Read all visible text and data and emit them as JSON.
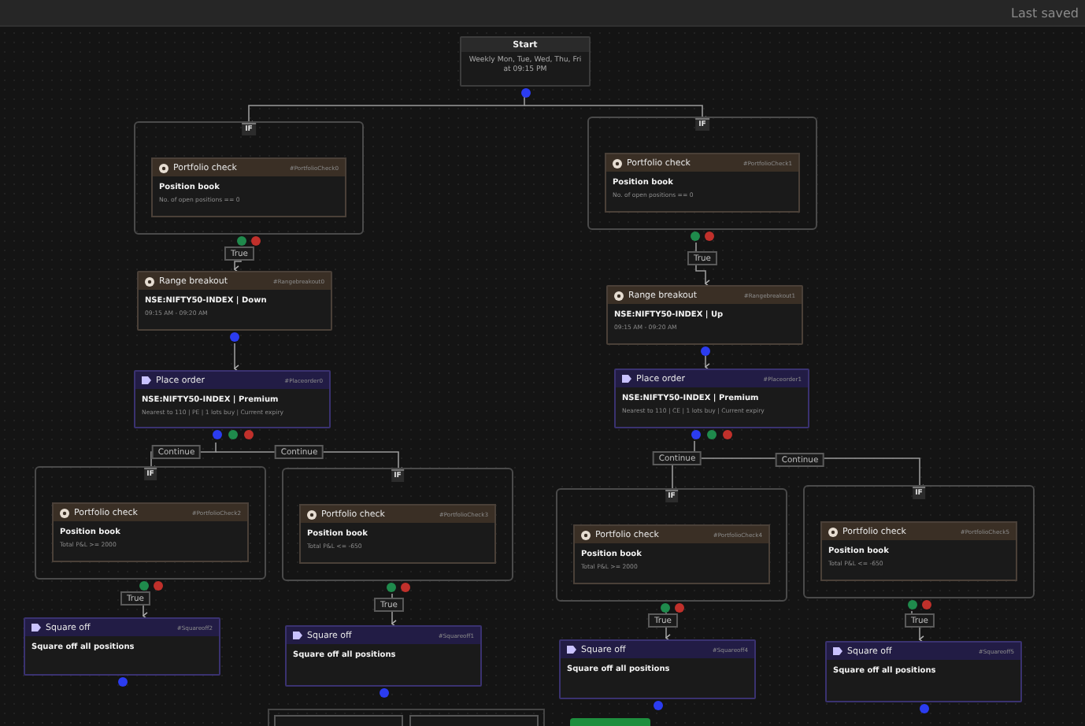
{
  "top_bar": {
    "status": "Last saved"
  },
  "nodes": [
    {
      "kind": "start",
      "title": "Start",
      "detail": "Weekly Mon, Tue, Wed, Thu, Fri at 09:15 PM",
      "ports": [
        {
          "color": "#2b3cf0"
        }
      ]
    },
    {
      "kind": "condition",
      "badge": "IF",
      "title": "Portfolio check",
      "tag": "#PortfolioCheck0",
      "heading": "Position book",
      "detail": "No. of open positions == 0",
      "ports": [
        {
          "color": "#1f8a4c"
        },
        {
          "color": "#c0302b"
        }
      ]
    },
    {
      "kind": "range_breakout",
      "title": "Range breakout",
      "tag": "#Rangebreakout0",
      "heading": "NSE:NIFTY50-INDEX | Down",
      "detail": "09:15 AM - 09:20 AM",
      "ports": [
        {
          "color": "#2b3cf0"
        }
      ]
    },
    {
      "kind": "place_order",
      "title": "Place order",
      "tag": "#Placeorder0",
      "heading": "NSE:NIFTY50-INDEX | Premium",
      "detail": "Nearest to 110 | PE | 1 lots buy | Current expiry",
      "ports": [
        {
          "color": "#2b3cf0"
        },
        {
          "color": "#1f8a4c"
        },
        {
          "color": "#c0302b"
        }
      ]
    },
    {
      "kind": "condition",
      "badge": "IF",
      "title": "Portfolio check",
      "tag": "#PortfolioCheck2",
      "heading": "Position book",
      "detail": "Total P&L >= 2000",
      "ports": [
        {
          "color": "#1f8a4c"
        },
        {
          "color": "#c0302b"
        }
      ]
    },
    {
      "kind": "square_off",
      "title": "Square off",
      "tag": "#Squareoff2",
      "heading": "Square off all positions",
      "ports": [
        {
          "color": "#2b3cf0"
        }
      ]
    },
    {
      "kind": "condition",
      "badge": "IF",
      "title": "Portfolio check",
      "tag": "#PortfolioCheck3",
      "heading": "Position book",
      "detail": "Total P&L <= -650",
      "ports": [
        {
          "color": "#1f8a4c"
        },
        {
          "color": "#c0302b"
        }
      ]
    },
    {
      "kind": "square_off",
      "title": "Square off",
      "tag": "#Squareoff1",
      "heading": "Square off all positions",
      "ports": [
        {
          "color": "#2b3cf0"
        }
      ]
    },
    {
      "kind": "condition",
      "badge": "IF",
      "title": "Portfolio check",
      "tag": "#PortfolioCheck1",
      "heading": "Position book",
      "detail": "No. of open positions == 0",
      "ports": [
        {
          "color": "#1f8a4c"
        },
        {
          "color": "#c0302b"
        }
      ]
    },
    {
      "kind": "range_breakout",
      "title": "Range breakout",
      "tag": "#Rangebreakout1",
      "heading": "NSE:NIFTY50-INDEX | Up",
      "detail": "09:15 AM - 09:20 AM",
      "ports": [
        {
          "color": "#2b3cf0"
        }
      ]
    },
    {
      "kind": "place_order",
      "title": "Place order",
      "tag": "#Placeorder1",
      "heading": "NSE:NIFTY50-INDEX | Premium",
      "detail": "Nearest to 110 | CE | 1 lots buy | Current expiry",
      "ports": [
        {
          "color": "#2b3cf0"
        },
        {
          "color": "#1f8a4c"
        },
        {
          "color": "#c0302b"
        }
      ]
    },
    {
      "kind": "condition",
      "badge": "IF",
      "title": "Portfolio check",
      "tag": "#PortfolioCheck4",
      "heading": "Position book",
      "detail": "Total P&L >= 2000",
      "ports": [
        {
          "color": "#1f8a4c"
        },
        {
          "color": "#c0302b"
        }
      ]
    },
    {
      "kind": "square_off",
      "title": "Square off",
      "tag": "#Squareoff4",
      "heading": "Square off all positions",
      "ports": [
        {
          "color": "#2b3cf0"
        }
      ]
    },
    {
      "kind": "condition",
      "badge": "IF",
      "title": "Portfolio check",
      "tag": "#PortfolioCheck5",
      "heading": "Position book",
      "detail": "Total P&L <= -650",
      "ports": [
        {
          "color": "#1f8a4c"
        },
        {
          "color": "#c0302b"
        }
      ]
    },
    {
      "kind": "square_off",
      "title": "Square off",
      "tag": "#Squareoff5",
      "heading": "Square off all positions",
      "ports": [
        {
          "color": "#2b3cf0"
        }
      ]
    }
  ],
  "edge_labels": [
    {
      "label": "True"
    },
    {
      "label": "True"
    },
    {
      "label": "Continue"
    },
    {
      "label": "Continue"
    },
    {
      "label": "True"
    },
    {
      "label": "True"
    },
    {
      "label": "Continue"
    },
    {
      "label": "Continue"
    },
    {
      "label": "True"
    },
    {
      "label": "True"
    }
  ]
}
